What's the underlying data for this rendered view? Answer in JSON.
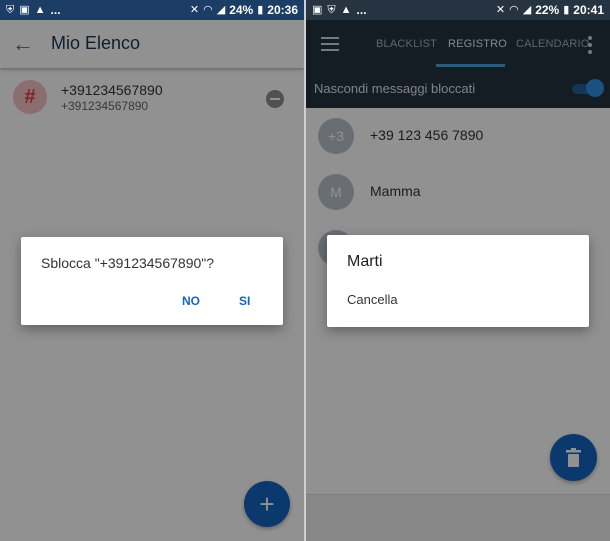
{
  "left": {
    "statusbar": {
      "dots": "...",
      "battery": "24%",
      "time": "20:36"
    },
    "appbar": {
      "title": "Mio Elenco"
    },
    "list": [
      {
        "avatar": "#",
        "primary": "+391234567890",
        "secondary": "+391234567890"
      }
    ],
    "dialog": {
      "message": "Sblocca \"+391234567890\"?",
      "no_label": "NO",
      "yes_label": "SI"
    },
    "fab_label": "+"
  },
  "right": {
    "statusbar": {
      "dots": "...",
      "battery": "22%",
      "time": "20:41"
    },
    "tabs": [
      "BLACKLIST",
      "REGISTRO",
      "CALENDARIO"
    ],
    "active_tab": "REGISTRO",
    "hide_blocked": {
      "label": "Nascondi messaggi bloccati",
      "enabled": true
    },
    "log": [
      {
        "avatar": "+3",
        "name": "+39 123 456 7890"
      },
      {
        "avatar": "M",
        "name": "Mamma"
      }
    ],
    "dialog": {
      "title": "Marti",
      "item": "Cancella"
    }
  },
  "colors": {
    "accent": "#1565c0",
    "toolbar_dark": "#263340",
    "status_left": "#1b3d66",
    "toggle_on": "#2e8fe0"
  }
}
